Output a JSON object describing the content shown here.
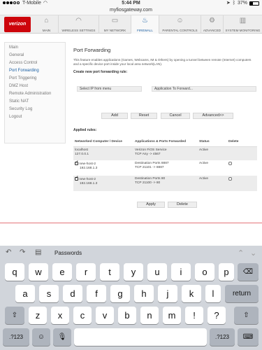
{
  "status_bar": {
    "carrier": "T-Mobile",
    "time": "5:44 PM",
    "battery": "37%"
  },
  "url": "myfiosgateway.com",
  "header": {
    "logo_text": "verizon",
    "nav": [
      {
        "label": "MAIN",
        "icon": "home-icon"
      },
      {
        "label": "WIRELESS SETTINGS",
        "icon": "wifi-icon"
      },
      {
        "label": "MY NETWORK",
        "icon": "computer-icon"
      },
      {
        "label": "FIREWALL",
        "icon": "flame-icon"
      },
      {
        "label": "PARENTAL CONTROLS",
        "icon": "people-icon"
      },
      {
        "label": "ADVANCED",
        "icon": "gear-icon"
      },
      {
        "label": "SYSTEM MONITORING",
        "icon": "bars-icon"
      }
    ],
    "active_nav": "FIREWALL"
  },
  "sidebar": {
    "items": [
      "Main",
      "General",
      "Access Control",
      "Port Forwarding",
      "Port Triggering",
      "DMZ Host",
      "Remote Administration",
      "Static NAT",
      "Security Log",
      "Logout"
    ],
    "active": "Port Forwarding"
  },
  "main": {
    "title": "Port Forwarding",
    "description": "This feature enables applications (Games, Webcams, IM & Others) by opening a tunnel between remote (Internet) computers and a specific device port inside your local area network(LAN).",
    "create_label": "Create new port forwarding rule:",
    "ip_select": "Select IP from menu",
    "app_select": "Application To Forward...",
    "buttons": {
      "add": "Add",
      "reset": "Reset",
      "cancel": "Cancel",
      "advanced": "Advanced>>"
    },
    "applied_label": "Applied rules:",
    "table": {
      "headers": [
        "Networked Computer / Device",
        "Applications & Ports Forwarded",
        "Status",
        "Delete"
      ],
      "rows": [
        {
          "device": "localhost",
          "ip": "127.0.0.1",
          "app": "Verizon FiOS Service",
          "ports": "TCP Any -> 4567",
          "status": "Active",
          "checked": false
        },
        {
          "device": "new-host-2",
          "ip": "192.168.1.3",
          "app": "Destination Ports 8887",
          "ports": "TCP 21101 -> 8887",
          "status": "Active",
          "checked": true
        },
        {
          "device": "new-host-2",
          "ip": "192.168.1.3",
          "app": "Destination Ports 80",
          "ports": "TCP 21100 -> 80",
          "status": "Active",
          "checked": true
        }
      ]
    },
    "apply_label": "Apply",
    "delete_label": "Delete"
  },
  "keyboard": {
    "toolbar_label": "Passwords",
    "row1": [
      "q",
      "w",
      "e",
      "r",
      "t",
      "y",
      "u",
      "i",
      "o",
      "p"
    ],
    "row2": [
      "a",
      "s",
      "d",
      "f",
      "g",
      "h",
      "j",
      "k",
      "l"
    ],
    "row3": [
      "z",
      "x",
      "c",
      "v",
      "b",
      "n",
      "m",
      "!",
      "?"
    ],
    "return_label": "return",
    "numbers_label": ".?123"
  }
}
